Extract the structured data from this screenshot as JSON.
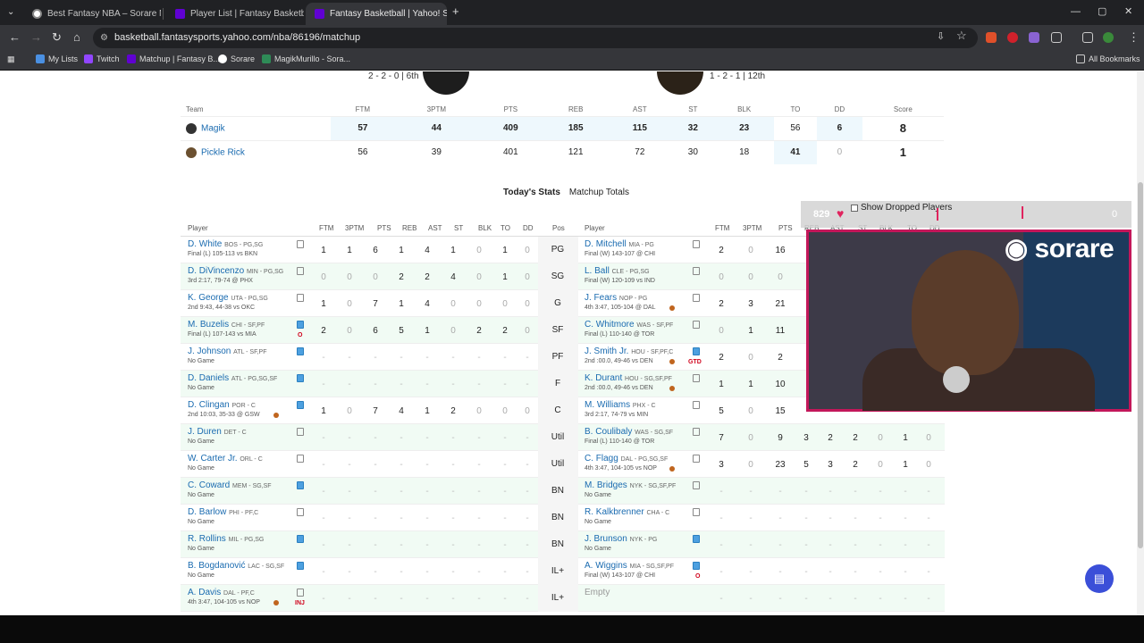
{
  "browser": {
    "tabs": [
      {
        "title": "Best Fantasy NBA – Sorare NBA",
        "active": false
      },
      {
        "title": "Player List | Fantasy Basketball |",
        "active": false
      },
      {
        "title": "Fantasy Basketball | Yahoo! Spo",
        "active": true
      }
    ],
    "new_tab": "+",
    "url": "basketball.fantasysports.yahoo.com/nba/86196/matchup",
    "bookmarks": [
      "My Lists",
      "Twitch",
      "Matchup | Fantasy B...",
      "Sorare",
      "MagikMurillo - Sora..."
    ],
    "all_bookmarks": "All Bookmarks"
  },
  "matchup": {
    "left_record": "2 - 2 - 0 | 6th",
    "right_record": "1 - 2 - 1 | 12th",
    "headers": [
      "Team",
      "FTM",
      "3PTM",
      "PTS",
      "REB",
      "AST",
      "ST",
      "BLK",
      "TO",
      "DD",
      "Score"
    ],
    "teams": [
      {
        "name": "Magik",
        "stats": [
          "57",
          "44",
          "409",
          "185",
          "115",
          "32",
          "23",
          "56",
          "6"
        ],
        "score": "8"
      },
      {
        "name": "Pickle Rick",
        "stats": [
          "56",
          "39",
          "401",
          "121",
          "72",
          "30",
          "18",
          "41",
          "0"
        ],
        "score": "1"
      }
    ]
  },
  "subtabs": {
    "today": "Today's Stats",
    "totals": "Matchup Totals"
  },
  "roster_header": {
    "left_player": "Player",
    "stat_cols": [
      "FTM",
      "3PTM",
      "PTS",
      "REB",
      "AST",
      "ST",
      "BLK",
      "TO",
      "DD"
    ],
    "pos": "Pos",
    "right_player": "Player",
    "right_stat_cols": [
      "FTM",
      "3PTM",
      "PTS",
      "REB",
      "AST",
      "ST",
      "BLK",
      "TO",
      "DD"
    ]
  },
  "rows": [
    {
      "pos": "PG",
      "l": {
        "name": "D. White",
        "team": "BOS - PG,SG",
        "sub": "Final (L) 105-113 vs BKN",
        "stats": [
          "1",
          "1",
          "6",
          "1",
          "4",
          "1",
          "0",
          "1",
          "0"
        ]
      },
      "r": {
        "name": "D. Mitchell",
        "team": "MIA - PG",
        "sub": "Final (W) 143-107 @ CHI",
        "stats": [
          "2",
          "0",
          "16",
          "",
          "",
          "",
          "",
          "",
          ""
        ]
      }
    },
    {
      "pos": "SG",
      "l": {
        "name": "D. DiVincenzo",
        "team": "MIN - PG,SG",
        "sub": "3rd 2:17, 79-74 @ PHX",
        "stats": [
          "0",
          "0",
          "0",
          "2",
          "2",
          "4",
          "0",
          "1",
          "0"
        ]
      },
      "r": {
        "name": "L. Ball",
        "team": "CLE - PG,SG",
        "sub": "Final (W) 120-109 vs IND",
        "stats": [
          "0",
          "0",
          "0",
          "",
          "",
          "",
          "",
          "",
          ""
        ]
      }
    },
    {
      "pos": "G",
      "l": {
        "name": "K. George",
        "team": "UTA - PG,SG",
        "sub": "2nd 9:43, 44-38 vs OKC",
        "stats": [
          "1",
          "0",
          "7",
          "1",
          "4",
          "0",
          "0",
          "0",
          "0"
        ]
      },
      "r": {
        "name": "J. Fears",
        "team": "NOP - PG",
        "sub": "4th 3:47, 105-104 @ DAL",
        "stats": [
          "2",
          "3",
          "21",
          "",
          "",
          "",
          "",
          "",
          ""
        ]
      }
    },
    {
      "pos": "SF",
      "l": {
        "name": "M. Buzelis",
        "team": "CHI - SF,PF",
        "sub": "Final (L) 107-143 vs MIA",
        "stats": [
          "2",
          "0",
          "6",
          "5",
          "1",
          "0",
          "2",
          "2",
          "0"
        ]
      },
      "r": {
        "name": "C. Whitmore",
        "team": "WAS - SF,PF",
        "sub": "Final (L) 110-140 @ TOR",
        "stats": [
          "0",
          "1",
          "11",
          "",
          "",
          "",
          "",
          "",
          ""
        ]
      }
    },
    {
      "pos": "PF",
      "l": {
        "name": "J. Johnson",
        "team": "ATL - SF,PF",
        "sub": "No Game",
        "stats": [
          "-",
          "-",
          "-",
          "-",
          "-",
          "-",
          "-",
          "-",
          "-"
        ]
      },
      "r": {
        "name": "J. Smith Jr.",
        "team": "HOU - SF,PF,C",
        "sub": "2nd :00.0, 49-46 vs DEN",
        "stats": [
          "2",
          "0",
          "2",
          "",
          "",
          "",
          "",
          "",
          ""
        ]
      }
    },
    {
      "pos": "F",
      "l": {
        "name": "D. Daniels",
        "team": "ATL - PG,SG,SF",
        "sub": "No Game",
        "stats": [
          "-",
          "-",
          "-",
          "-",
          "-",
          "-",
          "-",
          "-",
          "-"
        ]
      },
      "r": {
        "name": "K. Durant",
        "team": "HOU - SG,SF,PF",
        "sub": "2nd :00.0, 49-46 vs DEN",
        "stats": [
          "1",
          "1",
          "10",
          "",
          "",
          "",
          "",
          "",
          ""
        ]
      }
    },
    {
      "pos": "C",
      "l": {
        "name": "D. Clingan",
        "team": "POR - C",
        "sub": "2nd 10:03, 35-33 @ GSW",
        "stats": [
          "1",
          "0",
          "7",
          "4",
          "1",
          "2",
          "0",
          "0",
          "0"
        ]
      },
      "r": {
        "name": "M. Williams",
        "team": "PHX - C",
        "sub": "3rd 2:17, 74-79 vs MIN",
        "stats": [
          "5",
          "0",
          "15",
          "",
          "",
          "",
          "",
          "",
          ""
        ]
      }
    },
    {
      "pos": "Util",
      "l": {
        "name": "J. Duren",
        "team": "DET - C",
        "sub": "No Game",
        "stats": [
          "-",
          "-",
          "-",
          "-",
          "-",
          "-",
          "-",
          "-",
          "-"
        ]
      },
      "r": {
        "name": "B. Coulibaly",
        "team": "WAS - SG,SF",
        "sub": "Final (L) 110-140 @ TOR",
        "stats": [
          "7",
          "0",
          "9",
          "3",
          "2",
          "2",
          "0",
          "1",
          "0"
        ]
      }
    },
    {
      "pos": "Util",
      "l": {
        "name": "W. Carter Jr.",
        "team": "ORL - C",
        "sub": "No Game",
        "stats": [
          "-",
          "-",
          "-",
          "-",
          "-",
          "-",
          "-",
          "-",
          "-"
        ]
      },
      "r": {
        "name": "C. Flagg",
        "team": "DAL - PG,SG,SF",
        "sub": "4th 3:47, 104-105 vs NOP",
        "stats": [
          "3",
          "0",
          "23",
          "5",
          "3",
          "2",
          "0",
          "1",
          "0"
        ]
      }
    },
    {
      "pos": "BN",
      "l": {
        "name": "C. Coward",
        "team": "MEM - SG,SF",
        "sub": "No Game",
        "stats": [
          "-",
          "-",
          "-",
          "-",
          "-",
          "-",
          "-",
          "-",
          "-"
        ]
      },
      "r": {
        "name": "M. Bridges",
        "team": "NYK - SG,SF,PF",
        "sub": "No Game",
        "stats": [
          "-",
          "-",
          "-",
          "-",
          "-",
          "-",
          "-",
          "-",
          "-"
        ]
      }
    },
    {
      "pos": "BN",
      "l": {
        "name": "D. Barlow",
        "team": "PHI - PF,C",
        "sub": "No Game",
        "stats": [
          "-",
          "-",
          "-",
          "-",
          "-",
          "-",
          "-",
          "-",
          "-"
        ]
      },
      "r": {
        "name": "R. Kalkbrenner",
        "team": "CHA - C",
        "sub": "No Game",
        "stats": [
          "-",
          "-",
          "-",
          "-",
          "-",
          "-",
          "-",
          "-",
          "-"
        ]
      }
    },
    {
      "pos": "BN",
      "l": {
        "name": "R. Rollins",
        "team": "MIL - PG,SG",
        "sub": "No Game",
        "stats": [
          "-",
          "-",
          "-",
          "-",
          "-",
          "-",
          "-",
          "-",
          "-"
        ]
      },
      "r": {
        "name": "J. Brunson",
        "team": "NYK - PG",
        "sub": "No Game",
        "stats": [
          "-",
          "-",
          "-",
          "-",
          "-",
          "-",
          "-",
          "-",
          "-"
        ]
      }
    },
    {
      "pos": "IL+",
      "l": {
        "name": "B. Bogdanović",
        "team": "LAC - SG,SF",
        "sub": "No Game",
        "stats": [
          "-",
          "-",
          "-",
          "-",
          "-",
          "-",
          "-",
          "-",
          "-"
        ]
      },
      "r": {
        "name": "A. Wiggins",
        "team": "MIA - SG,SF,PF",
        "sub": "Final (W) 143-107 @ CHI",
        "stats": [
          "-",
          "-",
          "-",
          "-",
          "-",
          "-",
          "-",
          "-",
          "-"
        ]
      }
    },
    {
      "pos": "IL+",
      "l": {
        "name": "A. Davis",
        "team": "DAL - PF,C",
        "sub": "4th 3:47, 104-105 vs NOP",
        "stats": [
          "-",
          "-",
          "-",
          "-",
          "-",
          "-",
          "-",
          "-",
          "-"
        ]
      },
      "r": {
        "name": "Empty",
        "team": "",
        "sub": "",
        "stats": [
          "-",
          "-",
          "-",
          "-",
          "-",
          "-",
          "-",
          "-",
          "-"
        ]
      }
    }
  ],
  "badges": {
    "buzelis": "O",
    "smith": "GTD",
    "wiggins": "O",
    "davis": "INJ"
  },
  "overlay": {
    "show_dropped": "Show Dropped Players",
    "count_left": "829",
    "count_right": "0"
  },
  "stream": {
    "brand": "sorare"
  },
  "colors": {
    "link": "#1a6bb0",
    "win_bg": "#eef8fd",
    "row_alt": "#f1fbf4",
    "cam_border": "#c3175a",
    "chat_btn": "#3b4fd8"
  }
}
